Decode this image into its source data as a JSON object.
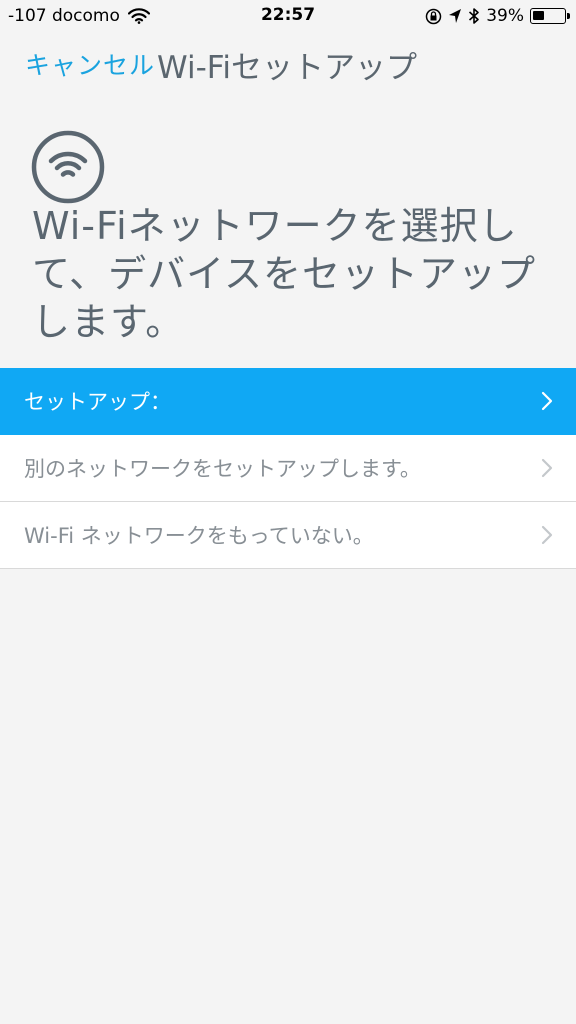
{
  "status_bar": {
    "carrier": "-107 docomo",
    "time": "22:57",
    "battery_percent": "39%",
    "battery_level": 0.39,
    "icons": [
      "wifi-icon",
      "orientation-lock-icon",
      "location-icon",
      "bluetooth-icon",
      "battery-icon"
    ]
  },
  "nav": {
    "cancel_label": "キャンセル",
    "title": "Wi-Fiセットアップ"
  },
  "hero": {
    "icon": "wifi-icon",
    "text": "Wi-Fiネットワークを選択して、デバイスをセットアップします。"
  },
  "list": {
    "items": [
      {
        "label": "セットアップ：",
        "selected": true
      },
      {
        "label": "別のネットワークをセットアップします。",
        "selected": false
      },
      {
        "label": "Wi-Fi ネットワークをもっていない。",
        "selected": false
      }
    ]
  },
  "colors": {
    "accent": "#1aa3df",
    "selected_row": "#10a8f4",
    "background": "#f4f4f4",
    "text_gray": "#5a6670"
  }
}
